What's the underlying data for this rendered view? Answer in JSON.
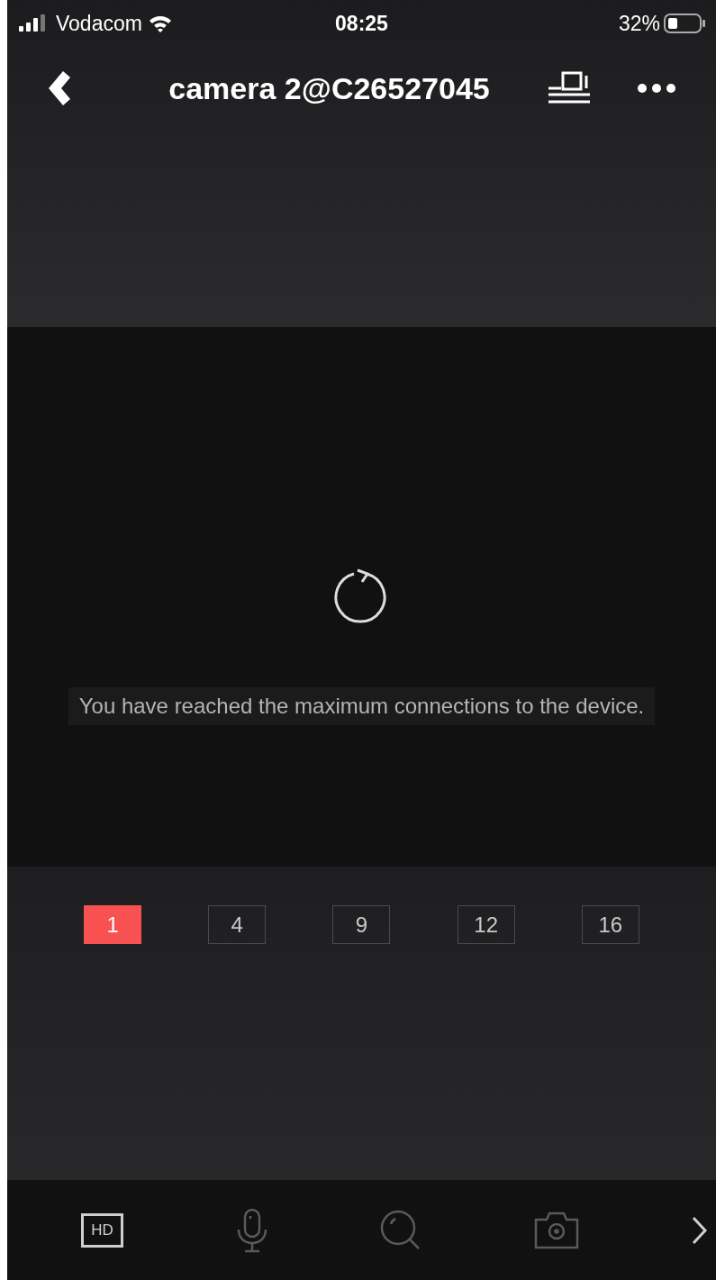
{
  "status_bar": {
    "carrier": "Vodacom",
    "time": "08:25",
    "battery": "32%"
  },
  "header": {
    "title": "camera 2@C26527045"
  },
  "video": {
    "message": "You have reached the maximum connections to the device."
  },
  "layouts": [
    {
      "label": "1",
      "selected": true
    },
    {
      "label": "4",
      "selected": false
    },
    {
      "label": "9",
      "selected": false
    },
    {
      "label": "12",
      "selected": false
    },
    {
      "label": "16",
      "selected": false
    }
  ],
  "toolbar": [
    {
      "kind": "hd",
      "label": "HD",
      "disabled": false
    },
    {
      "kind": "mic",
      "disabled": true
    },
    {
      "kind": "zoom",
      "disabled": true
    },
    {
      "kind": "camera",
      "disabled": true
    },
    {
      "kind": "next",
      "disabled": false
    }
  ]
}
